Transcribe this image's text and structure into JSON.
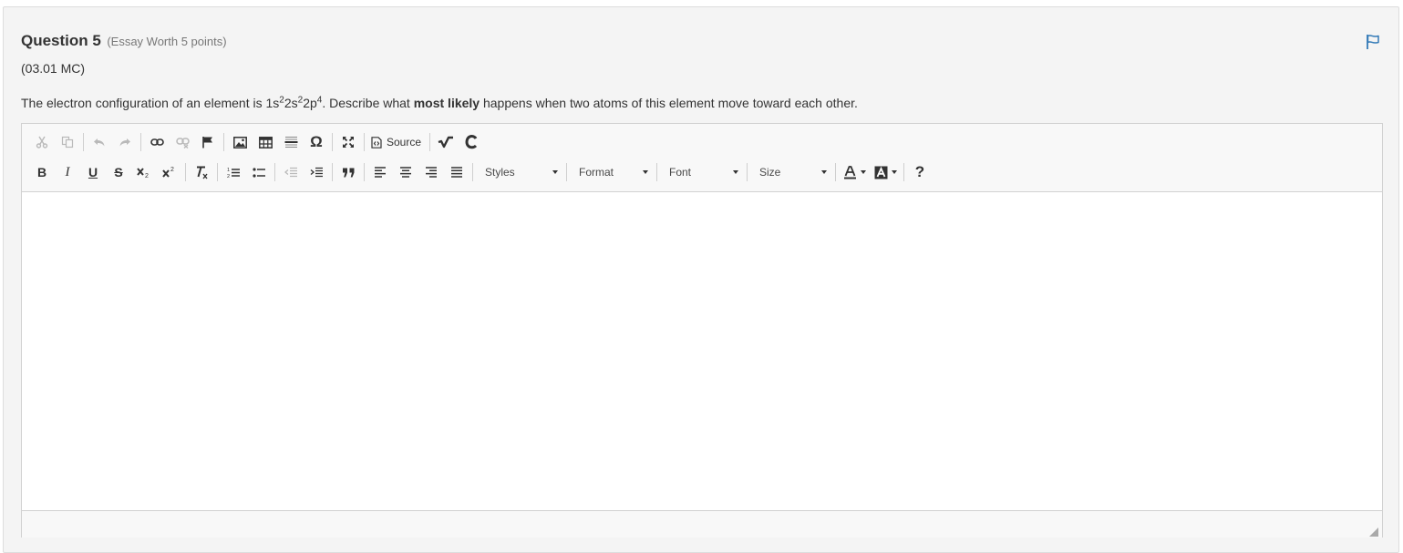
{
  "question": {
    "title": "Question 5",
    "subtitle": "(Essay Worth 5 points)",
    "code": "(03.01 MC)",
    "text_before": "The electron configuration of an element is 1s",
    "sup1": "2",
    "mid1": "2s",
    "sup2": "2",
    "mid2": "2p",
    "sup3": "4",
    "text_mid": ". Describe what ",
    "text_bold": "most likely",
    "text_after": " happens when two atoms of this element move toward each other."
  },
  "editor": {
    "source_label": "Source",
    "styles_label": "Styles",
    "format_label": "Format",
    "font_label": "Font",
    "size_label": "Size",
    "help_label": "?",
    "content": ""
  },
  "colors": {
    "accent": "#337ab7",
    "panel_bg": "#f4f4f4",
    "toolbar_bg": "#f8f8f8"
  }
}
